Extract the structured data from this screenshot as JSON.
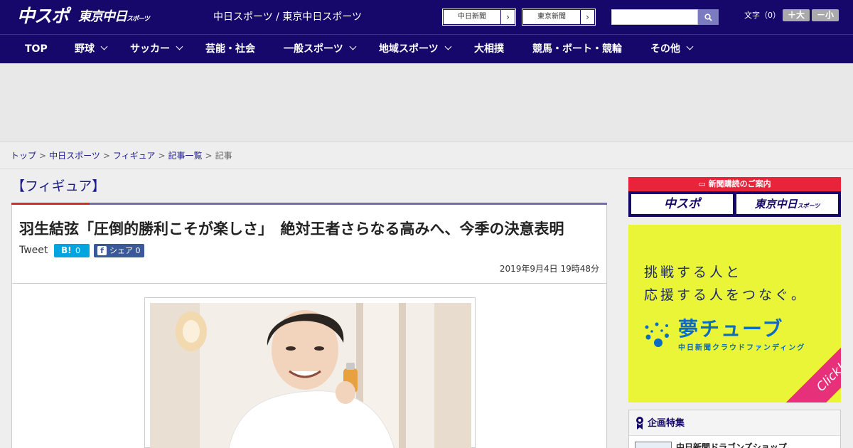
{
  "header": {
    "logo_main": "中スポ",
    "logo_tokyo": "東京中日",
    "logo_tokyo_suffix": "スポーツ",
    "site_title": "中日スポーツ / 東京中日スポーツ",
    "ext_links": [
      {
        "label": "中日新聞",
        "arrow": "›"
      },
      {
        "label": "東京新聞",
        "arrow": "›"
      }
    ],
    "search": {
      "value": "",
      "icon": "search-icon"
    },
    "font_size": {
      "label": "文字（0）",
      "larger": "＋大",
      "smaller": "－小"
    }
  },
  "nav": {
    "items": [
      {
        "label": "TOP",
        "has_menu": false
      },
      {
        "label": "野球",
        "has_menu": true
      },
      {
        "label": "サッカー",
        "has_menu": true
      },
      {
        "label": "芸能・社会",
        "has_menu": false
      },
      {
        "label": "一般スポーツ",
        "has_menu": true
      },
      {
        "label": "地域スポーツ",
        "has_menu": true
      },
      {
        "label": "大相撲",
        "has_menu": false
      },
      {
        "label": "競馬・ボート・競輪",
        "has_menu": false
      },
      {
        "label": "その他",
        "has_menu": true
      }
    ]
  },
  "breadcrumb": {
    "items": [
      "トップ",
      "中日スポーツ",
      "フィギュア",
      "記事一覧"
    ],
    "current": "記事",
    "separator": ">"
  },
  "article": {
    "category": "【フィギュア】",
    "headline": "羽生結弦「圧倒的勝利こそが楽しさ」　絶対王者さらなる高みへ、今季の決意表明",
    "tweet_label": "Tweet",
    "hatena": {
      "label": "B!",
      "count": "0"
    },
    "facebook": {
      "label": "シェア",
      "count": "0",
      "icon": "f"
    },
    "date": "2019年9月4日 19時48分"
  },
  "sidebar": {
    "subscription": {
      "title": "新聞購読のご案内",
      "buttons": [
        "中スポ",
        "東京中日"
      ],
      "tokyo_suffix": "スポーツ"
    },
    "banner": {
      "line1": "挑戦する人と",
      "line2": "応援する人をつなぐ。",
      "title": "夢チューブ",
      "subtitle": "中日新聞クラウドファンディング",
      "cta": "Click!"
    },
    "features": {
      "title": "企画特集",
      "item": "中日新聞ドラゴンズショップ"
    }
  },
  "colors": {
    "header_bg": "#15086a",
    "accent_red": "#d42b2b",
    "rule_purple": "#756bb3",
    "banner_yellow": "#ebf538",
    "banner_blue": "#0b6cc2",
    "cta_pink": "#e6317a"
  }
}
